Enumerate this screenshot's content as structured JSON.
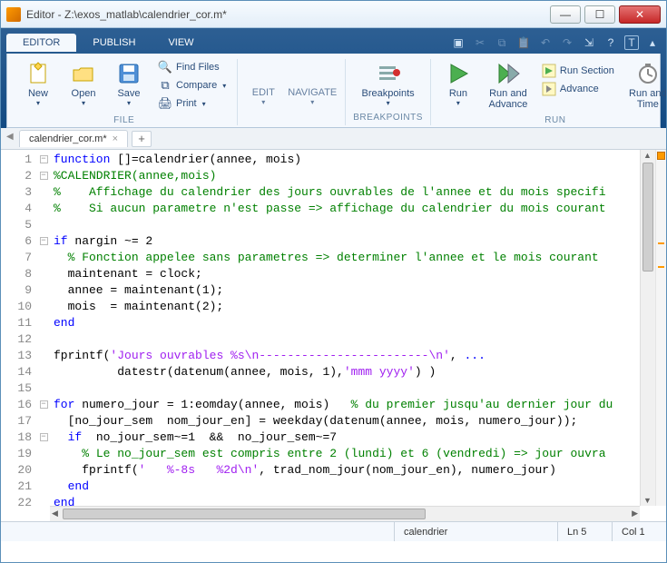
{
  "window": {
    "title": "Editor - Z:\\exos_matlab\\calendrier_cor.m*"
  },
  "ribbon": {
    "tabs": {
      "editor": "EDITOR",
      "publish": "PUBLISH",
      "view": "VIEW"
    },
    "file": {
      "new": "New",
      "open": "Open",
      "save": "Save",
      "findfiles": "Find Files",
      "compare": "Compare",
      "print": "Print",
      "label": "FILE"
    },
    "nav": {
      "edit": "EDIT",
      "navigate": "NAVIGATE"
    },
    "bp": {
      "breakpoints": "Breakpoints",
      "label": "BREAKPOINTS"
    },
    "run": {
      "run": "Run",
      "runadv": "Run and\nAdvance",
      "runsection": "Run Section",
      "advance": "Advance",
      "runtime": "Run and\nTime",
      "label": "RUN"
    }
  },
  "filetab": {
    "name": "calendrier_cor.m*"
  },
  "code": {
    "lines": [
      {
        "n": 1,
        "fold": "⊟",
        "html": "<span class='kw'>function</span> []=calendrier(annee, mois)"
      },
      {
        "n": 2,
        "fold": "⊟",
        "html": "<span class='cm'>%CALENDRIER(annee,mois)</span>"
      },
      {
        "n": 3,
        "fold": "",
        "html": "<span class='cm'>%    Affichage du calendrier des jours ouvrables de l'annee et du mois specifi</span>"
      },
      {
        "n": 4,
        "fold": "",
        "html": "<span class='cm'>%    Si aucun parametre n'est passe =&gt; affichage du calendrier du mois courant</span>"
      },
      {
        "n": 5,
        "fold": "",
        "html": ""
      },
      {
        "n": 6,
        "fold": "⊟",
        "html": "<span class='kw'>if</span> nargin ~= 2"
      },
      {
        "n": 7,
        "fold": "",
        "html": "  <span class='cm'>% Fonction appelee sans parametres =&gt; determiner l'annee et le mois courant</span>"
      },
      {
        "n": 8,
        "fold": "",
        "html": "  maintenant = clock;"
      },
      {
        "n": 9,
        "fold": "",
        "html": "  annee = maintenant(1);"
      },
      {
        "n": 10,
        "fold": "",
        "html": "  mois  = maintenant(2);"
      },
      {
        "n": 11,
        "fold": "",
        "html": "<span class='kw'>end</span>"
      },
      {
        "n": 12,
        "fold": "",
        "html": ""
      },
      {
        "n": 13,
        "fold": "",
        "html": "fprintf(<span class='st'>'Jours ouvrables %s\\n------------------------\\n'</span>, <span class='kw'>...</span>"
      },
      {
        "n": 14,
        "fold": "",
        "html": "         datestr(datenum(annee, mois, 1),<span class='st'>'mmm yyyy'</span>) )"
      },
      {
        "n": 15,
        "fold": "",
        "html": ""
      },
      {
        "n": 16,
        "fold": "⊟",
        "html": "<span class='kw'>for</span> numero_jour = 1:eomday(annee, mois)   <span class='cm'>% du premier jusqu'au dernier jour du</span>"
      },
      {
        "n": 17,
        "fold": "",
        "html": "  [no_jour_sem  nom_jour_en] = weekday(datenum(annee, mois, numero_jour));"
      },
      {
        "n": 18,
        "fold": "⊟",
        "html": "  <span class='kw'>if</span>  no_jour_sem~=1  &amp;&amp;  no_jour_sem~=7"
      },
      {
        "n": 19,
        "fold": "",
        "html": "    <span class='cm'>% Le no_jour_sem est compris entre 2 (lundi) et 6 (vendredi) =&gt; jour ouvra</span>"
      },
      {
        "n": 20,
        "fold": "",
        "html": "    fprintf(<span class='st'>'   %-8s   %2d\\n'</span>, trad_nom_jour(nom_jour_en), numero_jour)"
      },
      {
        "n": 21,
        "fold": "",
        "html": "  <span class='kw'>end</span>"
      },
      {
        "n": 22,
        "fold": "",
        "html": "<span class='kw'>end</span>"
      }
    ]
  },
  "status": {
    "func": "calendrier",
    "ln": "Ln  5",
    "col": "Col  1"
  }
}
